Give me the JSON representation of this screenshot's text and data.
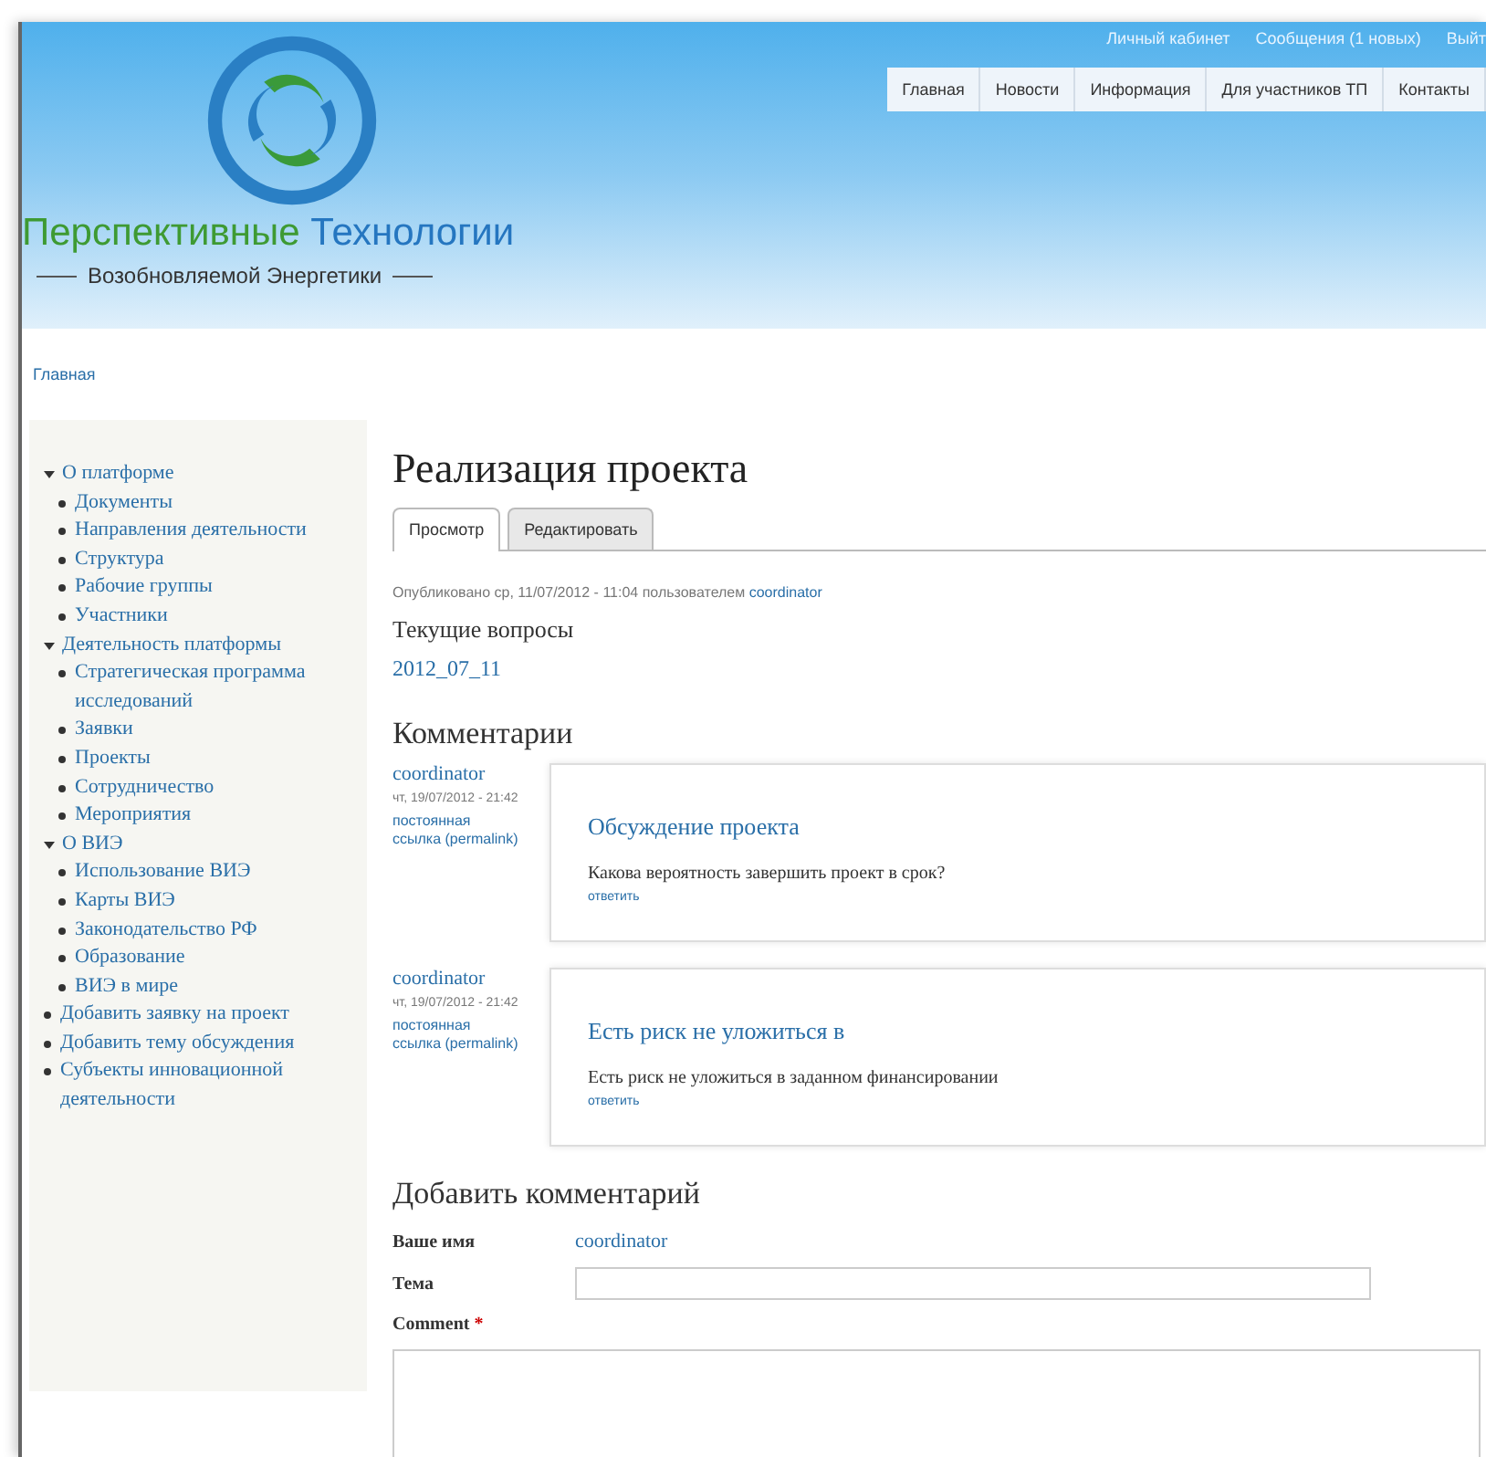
{
  "user_links": [
    "Личный кабинет",
    "Сообщения (1 новых)",
    "Выйт"
  ],
  "nav": [
    {
      "label": "Главная",
      "selected": false
    },
    {
      "label": "Новости",
      "selected": false
    },
    {
      "label": "Информация",
      "selected": false
    },
    {
      "label": "Для участников ТП",
      "selected": false
    },
    {
      "label": "Контакты",
      "selected": false
    }
  ],
  "logo": {
    "word_1": "Перспективные",
    "word_2": "Технологии",
    "subtitle": "Возобновляемой Энергетики"
  },
  "breadcrumb": "Главная",
  "sidebar": {
    "items": [
      {
        "label": "О платформе",
        "expanded": true,
        "children": [
          {
            "label": "Документы"
          },
          {
            "label": "Направления деятельности"
          },
          {
            "label": "Структура"
          },
          {
            "label": "Рабочие группы"
          },
          {
            "label": "Участники"
          }
        ]
      },
      {
        "label": "Деятельность платформы",
        "expanded": true,
        "children": [
          {
            "label": "Стратегическая программа исследований"
          },
          {
            "label": "Заявки"
          },
          {
            "label": "Проекты"
          },
          {
            "label": "Сотрудничество"
          },
          {
            "label": "Мероприятия"
          }
        ]
      },
      {
        "label": "О ВИЭ",
        "expanded": true,
        "children": [
          {
            "label": "Использование ВИЭ"
          },
          {
            "label": "Карты ВИЭ"
          },
          {
            "label": "Законодательство РФ"
          },
          {
            "label": "Образование"
          },
          {
            "label": "ВИЭ в мире"
          }
        ]
      },
      {
        "label": "Добавить заявку на проект",
        "expanded": false
      },
      {
        "label": "Добавить тему обсуждения",
        "expanded": false
      },
      {
        "label": "Субъекты инновационной деятельности",
        "expanded": false
      }
    ]
  },
  "page": {
    "title": "Реализация проекта",
    "tabs": [
      {
        "label": "Просмотр",
        "selected": true
      },
      {
        "label": "Редактировать",
        "selected": false
      }
    ],
    "submitted": "Опубликовано ср, 11/07/2012 - 11:04 пользователем",
    "submitted_author": "coordinator",
    "field_label": "Текущие вопросы",
    "field_value": "2012_07_11"
  },
  "comments": {
    "title": "Комментарии",
    "items": [
      {
        "author": "coordinator",
        "date": "чт, 19/07/2012 - 21:42",
        "permalink": "постоянная ссылка (permalink)",
        "title": "Обсуждение проекта",
        "body": "Какова вероятность завершить проект в срок?",
        "reply": "ответить"
      },
      {
        "author": "coordinator",
        "date": "чт, 19/07/2012 - 21:42",
        "permalink": "постоянная ссылка (permalink)",
        "title": "Есть риск не уложиться в",
        "body": "Есть риск не уложиться в заданном финансировании",
        "reply": "ответить"
      }
    ]
  },
  "comment_form": {
    "title": "Добавить комментарий",
    "name_label": "Ваше имя",
    "name_value": "coordinator",
    "subject_label": "Тема",
    "comment_label": "Comment",
    "required_mark": "*"
  }
}
